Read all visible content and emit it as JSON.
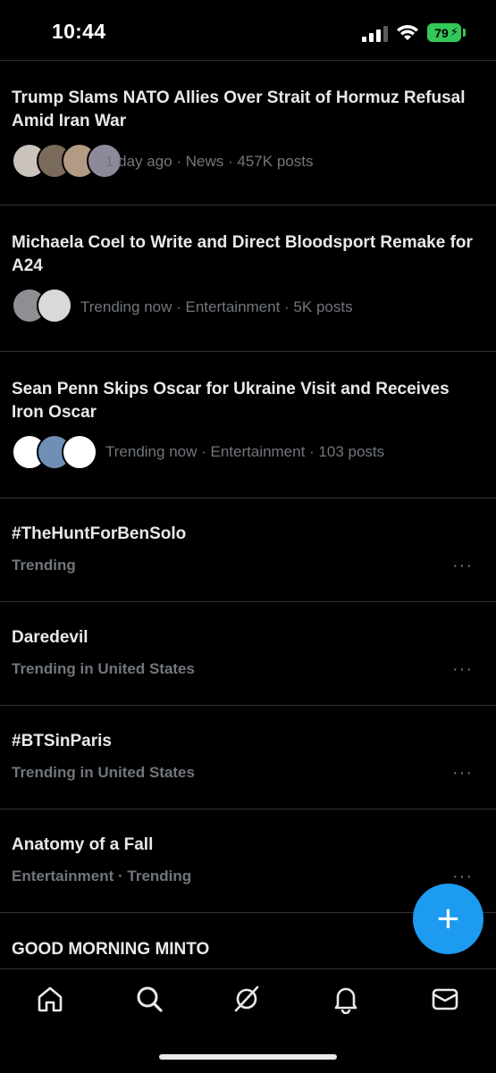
{
  "status_bar": {
    "time": "10:44",
    "battery": "79"
  },
  "stories": [
    {
      "title": "Trump Slams NATO Allies Over Strait of Hormuz Refusal Amid Iran War",
      "meta": "1 day ago · News · 457K posts",
      "avatar_colors": [
        "#c9c3bb",
        "#7a6a5a",
        "#b39a84",
        "#8c8a9a"
      ]
    },
    {
      "title": "Michaela Coel to Write and Direct Bloodsport Remake for A24",
      "meta": "Trending now · Entertainment · 5K posts",
      "avatar_colors": [
        "#8e8e93",
        "#d9d9d9"
      ]
    },
    {
      "title": "Sean Penn Skips Oscar for Ukraine Visit and Receives Iron Oscar",
      "meta": "Trending now · Entertainment · 103 posts",
      "avatar_colors": [
        "#ffffff",
        "#6f8fb5",
        "#ffffff"
      ]
    }
  ],
  "trends": [
    {
      "name": "#TheHuntForBenSolo",
      "context": "Trending"
    },
    {
      "name": "Daredevil",
      "context": "Trending in United States"
    },
    {
      "name": "#BTSinParis",
      "context": "Trending in United States"
    },
    {
      "name": "Anatomy of a Fall",
      "context": "Entertainment · Trending"
    },
    {
      "name": "GOOD MORNING MINTO",
      "context": ""
    }
  ],
  "fab": {
    "icon": "plus-icon",
    "label": "+"
  },
  "bottom_nav": [
    "home-icon",
    "search-icon",
    "grok-icon",
    "notifications-icon",
    "messages-icon"
  ],
  "colors": {
    "background": "#000000",
    "text": "#e7e9ea",
    "secondary": "#71767b",
    "accent": "#1d9bf0",
    "divider": "#2f3336",
    "battery": "#34c759"
  }
}
